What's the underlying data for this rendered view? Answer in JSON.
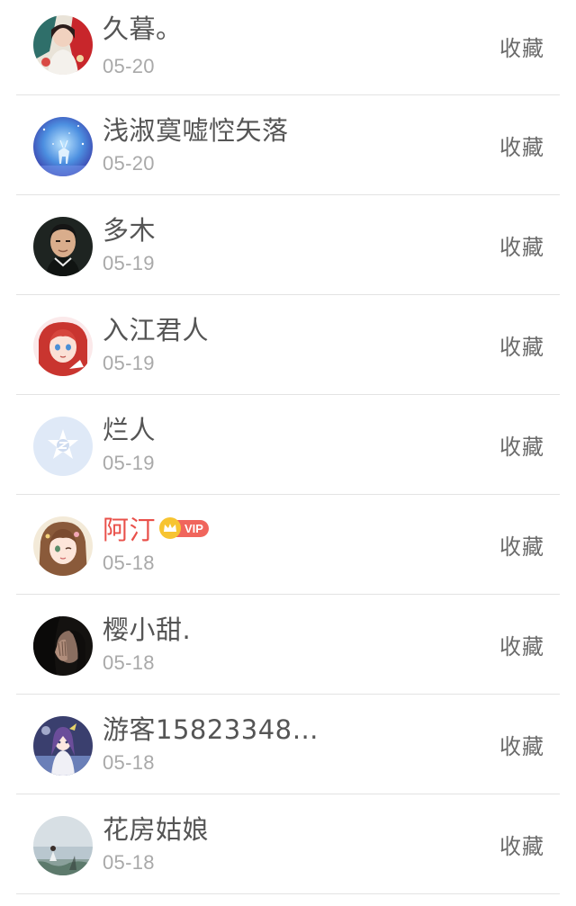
{
  "favorites_list": {
    "action_label": "收藏",
    "items": [
      {
        "name": "久暮。",
        "date": "05-20",
        "avatar": "woman-in-red-floral-avatar-icon",
        "vip": false
      },
      {
        "name": "浅淑寞嘘悾矢落",
        "date": "05-20",
        "avatar": "blue-deer-night-avatar-icon",
        "vip": false
      },
      {
        "name": "多木",
        "date": "05-19",
        "avatar": "man-portrait-avatar-icon",
        "vip": false
      },
      {
        "name": "入江君人",
        "date": "05-19",
        "avatar": "anime-redhead-girl-avatar-icon",
        "vip": false
      },
      {
        "name": "烂人",
        "date": "05-19",
        "avatar": "default-qq-avatar-icon",
        "vip": false
      },
      {
        "name": "阿汀",
        "date": "05-18",
        "avatar": "anime-girl-winking-avatar-icon",
        "vip": true,
        "vip_label": "VIP"
      },
      {
        "name": "樱小甜.",
        "date": "05-18",
        "avatar": "girl-hand-face-dark-avatar-icon",
        "vip": false
      },
      {
        "name": "游客15823348…",
        "date": "05-18",
        "avatar": "anime-purple-girl-avatar-icon",
        "vip": false
      },
      {
        "name": "花房姑娘",
        "date": "05-18",
        "avatar": "seaside-figure-avatar-icon",
        "vip": false
      }
    ]
  },
  "colors": {
    "vip_name": "#e9504a",
    "vip_badge": "#f0655c",
    "vip_crown": "#f7c431",
    "date_text": "#a9a9a9",
    "divider": "#e3e3e3"
  }
}
